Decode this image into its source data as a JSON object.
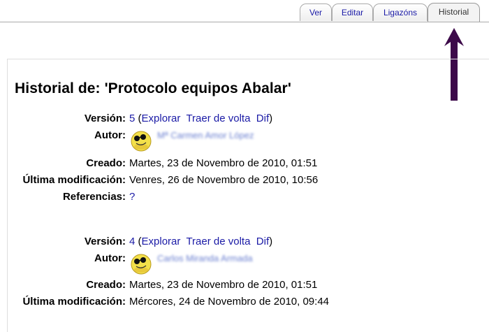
{
  "tabs": [
    {
      "label": "Ver"
    },
    {
      "label": "Editar"
    },
    {
      "label": "Ligazóns"
    },
    {
      "label": "Historial"
    }
  ],
  "page_title": "Historial de: 'Protocolo equipos Abalar'",
  "labels": {
    "version": "Versión:",
    "author": "Autor:",
    "created": "Creado:",
    "modified": "Última modificación:",
    "references": "Referencias:"
  },
  "actions": {
    "explore": "Explorar",
    "revert": "Traer de volta",
    "diff": "Dif"
  },
  "versions": [
    {
      "number": "5",
      "author": "Mª Carmen Amor López",
      "created": "Martes, 23 de Novembro de 2010, 01:51",
      "modified": "Venres, 26 de Novembro de 2010, 10:56",
      "references": "?"
    },
    {
      "number": "4",
      "author": "Carlos Miranda Armada",
      "created": "Martes, 23 de Novembro de 2010, 01:51",
      "modified": "Mércores, 24 de Novembro de 2010, 09:44"
    }
  ],
  "colors": {
    "link": "#1a1aa6",
    "annotation_arrow": "#3d0a4a"
  },
  "icons": {
    "avatar": "smiley-sunglasses-icon",
    "annotation": "arrow-up-icon"
  }
}
